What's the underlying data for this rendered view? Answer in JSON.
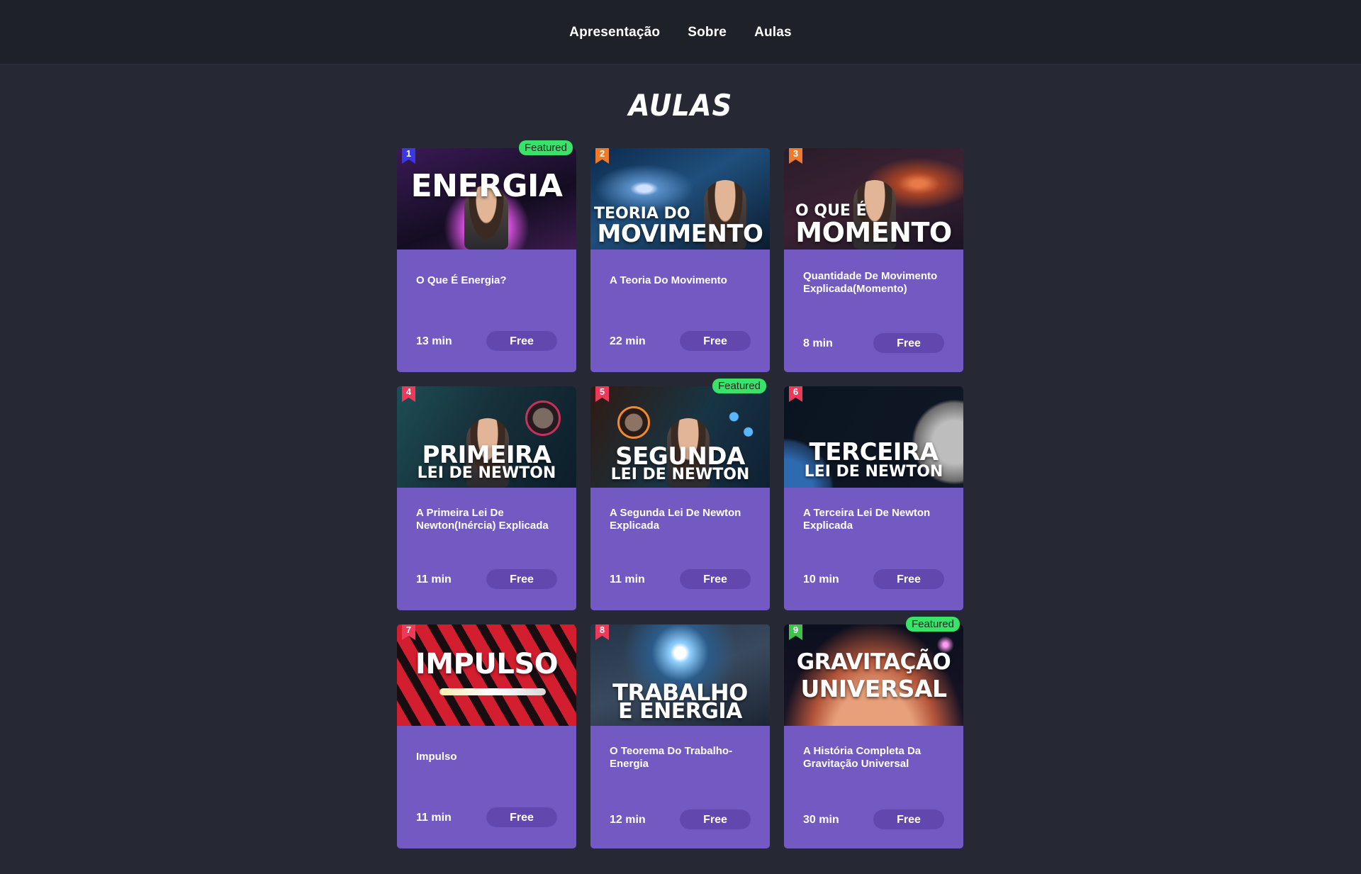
{
  "nav": {
    "items": [
      {
        "label": "Apresentação"
      },
      {
        "label": "Sobre"
      },
      {
        "label": "Aulas"
      }
    ]
  },
  "section": {
    "title": "AULAS"
  },
  "colors": {
    "background": "#262833",
    "nav_background": "#1f2129",
    "card": "#735ac3",
    "price_pill": "#6248ae",
    "featured_badge": "#39e36b"
  },
  "courses": [
    {
      "number": "1",
      "ribbon_color": "#3b37e6",
      "featured": "Featured",
      "thumb_line1": "",
      "thumb_line2": "ENERGIA",
      "title": "O Que É Energia?",
      "duration": "13 min",
      "price": "Free"
    },
    {
      "number": "2",
      "ribbon_color": "#f07a2c",
      "featured": "",
      "thumb_line1": "TEORIA DO",
      "thumb_line2": "MOVIMENTO",
      "title": "A Teoria Do Movimento",
      "duration": "22 min",
      "price": "Free"
    },
    {
      "number": "3",
      "ribbon_color": "#f07a2c",
      "featured": "",
      "thumb_line1": "O QUE É",
      "thumb_line2": "MOMENTO",
      "title": "Quantidade De Movimento Explicada(Momento)",
      "duration": "8 min",
      "price": "Free"
    },
    {
      "number": "4",
      "ribbon_color": "#ee3a5a",
      "featured": "",
      "thumb_line1": "PRIMEIRA",
      "thumb_line2": "LEI DE NEWTON",
      "title": "A Primeira Lei De Newton(Inércia) Explicada",
      "duration": "11 min",
      "price": "Free"
    },
    {
      "number": "5",
      "ribbon_color": "#ee3a5a",
      "featured": "Featured",
      "thumb_line1": "SEGUNDA",
      "thumb_line2": "LEI DE NEWTON",
      "title": "A Segunda Lei De Newton Explicada",
      "duration": "11 min",
      "price": "Free"
    },
    {
      "number": "6",
      "ribbon_color": "#ee3a5a",
      "featured": "",
      "thumb_line1": "TERCEIRA",
      "thumb_line2": "LEI DE NEWTON",
      "title": "A Terceira Lei De Newton Explicada",
      "duration": "10 min",
      "price": "Free"
    },
    {
      "number": "7",
      "ribbon_color": "#ee3a5a",
      "featured": "",
      "thumb_line1": "",
      "thumb_line2": "IMPULSO",
      "title": "Impulso",
      "duration": "11 min",
      "price": "Free"
    },
    {
      "number": "8",
      "ribbon_color": "#ee3a5a",
      "featured": "",
      "thumb_line1": "TRABALHO",
      "thumb_line2": "E ENERGIA",
      "title": "O Teorema Do Trabalho-Energia",
      "duration": "12 min",
      "price": "Free"
    },
    {
      "number": "9",
      "ribbon_color": "#3bc34a",
      "featured": "Featured",
      "thumb_line1": "GRAVITAÇÃO",
      "thumb_line2": "UNIVERSAL",
      "title": "A História Completa Da Gravitação Universal",
      "duration": "30 min",
      "price": "Free"
    }
  ]
}
